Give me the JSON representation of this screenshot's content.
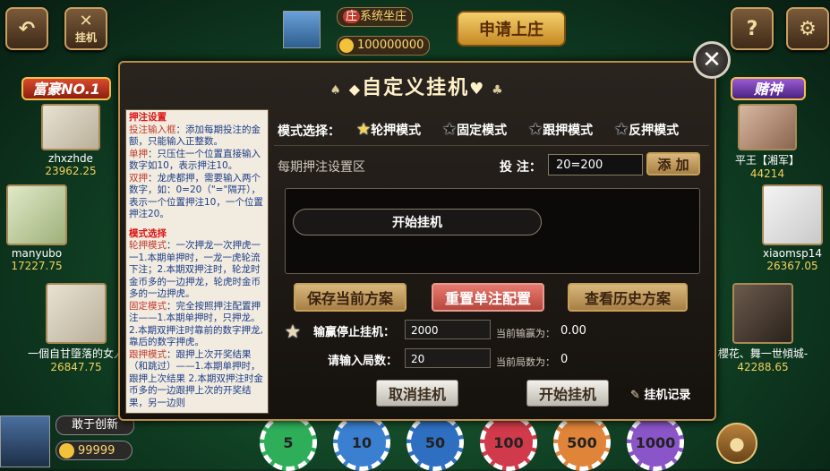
{
  "top": {
    "back_icon": "back-arrow-icon",
    "hangup_label": "挂机",
    "banker_prefix": "庄",
    "banker_name": "系统坐庄",
    "banker_gold": "100000000",
    "apply_banker": "申请上庄",
    "help_icon": "question-icon",
    "settings_icon": "gear-icon"
  },
  "players_left": [
    {
      "badge": "富豪NO.1",
      "name": "zhxzhde",
      "score": "23962.25"
    },
    {
      "name": "manyubo",
      "score": "17227.75"
    },
    {
      "name": "一個自甘墮落的女人",
      "score": "26847.75"
    }
  ],
  "players_right": [
    {
      "badge": "赌神",
      "name": "平王【湘军】",
      "score": "44214"
    },
    {
      "name": "xiaomsp14",
      "score": "26367.05"
    },
    {
      "name": "櫻花、舞一世傾城-",
      "score": "42288.65"
    }
  ],
  "me": {
    "name": "敢于创新",
    "gold": "99999"
  },
  "chips": [
    "5",
    "10",
    "50",
    "100",
    "500",
    "1000"
  ],
  "dialog": {
    "title": "自定义挂机",
    "help": {
      "h1": "押注设置",
      "p1_key": "投注输入框",
      "p1": "：添加每期投注的金额，只能输入正整数。",
      "p2_key": "单押",
      "p2": "：只压住一个位置直接输入数字如10，表示押注10。",
      "p3_key": "双押",
      "p3": "：龙虎都押，需要输入两个数字，如：0=20（\"=\"隔开），表示一个位置押注10，一个位置押注20。",
      "h2": "模式选择",
      "p4_key": "轮押模式",
      "p4": "：一次押龙一次押虎一一1.本期单押时，一龙一虎轮流下注；2.本期双押注时，轮龙时金币多的一边押龙，轮虎时金币多的一边押虎。",
      "p5_key": "固定模式",
      "p5": "：完全按照押注配置押注——1.本期单押时，只押龙。2.本期双押注时靠前的数字押龙,靠后的数字押虎。",
      "p6_key": "跟押模式",
      "p6": "：跟押上次开奖结果（和跳过）——1.本期单押时，跟押上次结果 2.本期双押注时金币多的一边跟押上次的开奖结果，另一边则"
    },
    "mode_label": "模式选择：",
    "modes": [
      "轮押模式",
      "固定模式",
      "跟押模式",
      "反押模式"
    ],
    "area_label": "每期押注设置区",
    "bet_label": "投  注：",
    "bet_value": "20=200",
    "add_label": "添  加",
    "start_pill": "开始挂机",
    "save_plan": "保存当前方案",
    "reset_config": "重置单注配置",
    "view_history": "查看历史方案",
    "stop_label": "输赢停止挂机：",
    "stop_value": "2000",
    "cur_win_label": "当前输赢为：",
    "cur_win_value": "0.00",
    "rounds_label": "请输入局数：",
    "rounds_value": "20",
    "cur_rounds_label": "当前局数为：",
    "cur_rounds_value": "0",
    "cancel_btn": "取消挂机",
    "start_btn": "开始挂机",
    "log_label": "挂机记录"
  }
}
